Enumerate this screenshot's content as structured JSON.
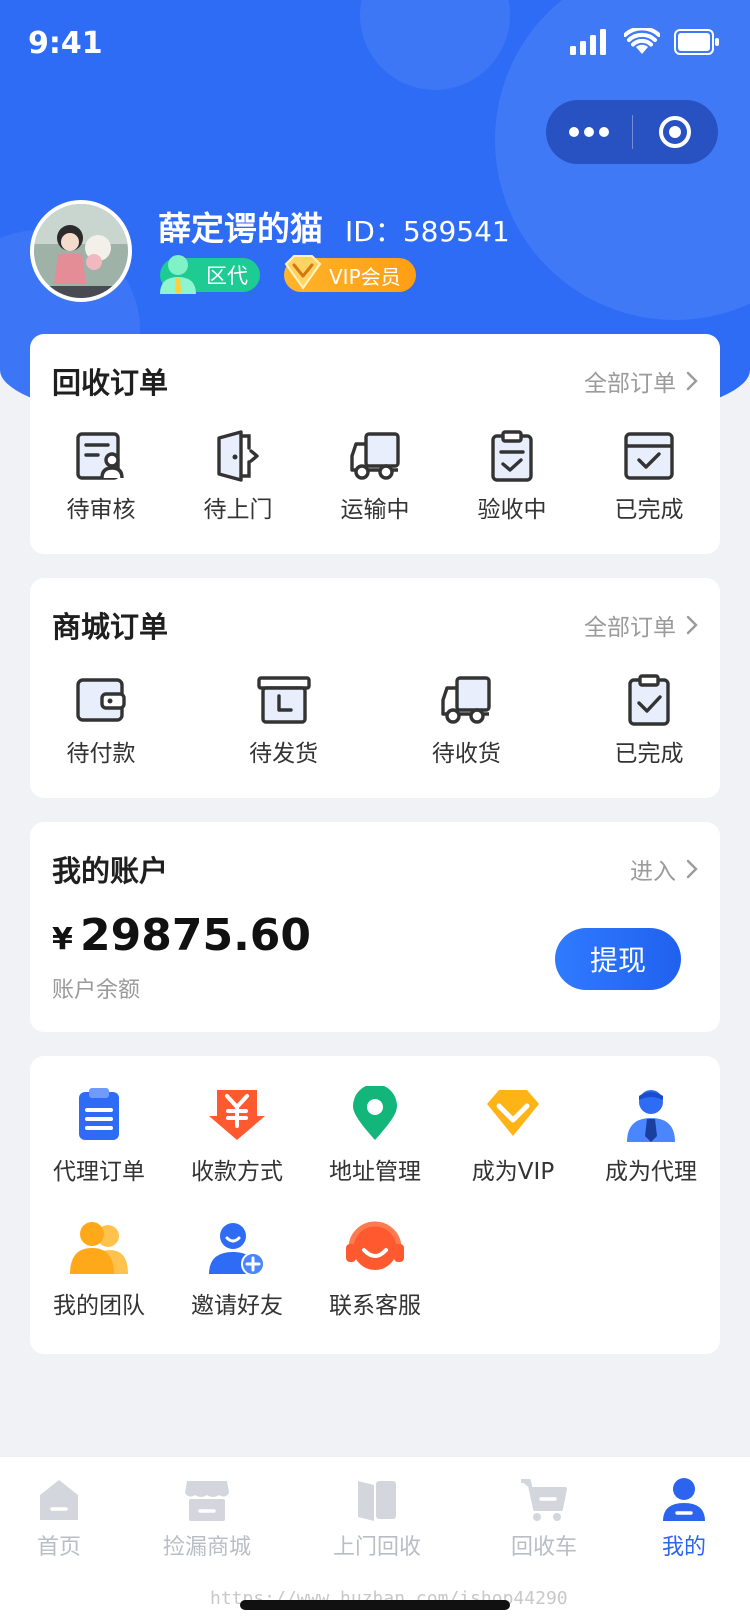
{
  "status_bar": {
    "time": "9:41"
  },
  "profile": {
    "name": "薛定谔的猫",
    "id_text": "ID：589541",
    "agent_badge": "区代",
    "vip_badge": "VIP会员"
  },
  "recycle_orders": {
    "title": "回收订单",
    "link": "全部订单",
    "items": [
      {
        "label": "待审核",
        "icon": "review-doc-icon"
      },
      {
        "label": "待上门",
        "icon": "door-icon"
      },
      {
        "label": "运输中",
        "icon": "truck-icon"
      },
      {
        "label": "验收中",
        "icon": "clipboard-check-icon"
      },
      {
        "label": "已完成",
        "icon": "box-check-icon"
      }
    ]
  },
  "mall_orders": {
    "title": "商城订单",
    "link": "全部订单",
    "items": [
      {
        "label": "待付款",
        "icon": "wallet-icon"
      },
      {
        "label": "待发货",
        "icon": "package-clock-icon"
      },
      {
        "label": "待收货",
        "icon": "truck-icon"
      },
      {
        "label": "已完成",
        "icon": "clipboard-check-icon"
      }
    ]
  },
  "account": {
    "title": "我的账户",
    "link": "进入",
    "currency": "¥",
    "balance": "29875.60",
    "balance_label": "账户余额",
    "withdraw_label": "提现"
  },
  "services": [
    {
      "label": "代理订单",
      "icon": "order-list-icon",
      "color": "#2e6cf6"
    },
    {
      "label": "收款方式",
      "icon": "yuan-payment-icon",
      "color": "#ff5a2f"
    },
    {
      "label": "地址管理",
      "icon": "location-pin-icon",
      "color": "#12b67a"
    },
    {
      "label": "成为VIP",
      "icon": "diamond-icon",
      "color": "#ffb416"
    },
    {
      "label": "成为代理",
      "icon": "agent-person-icon",
      "color": "#2e6cf6"
    },
    {
      "label": "我的团队",
      "icon": "team-icon",
      "color": "#ffa81a"
    },
    {
      "label": "邀请好友",
      "icon": "invite-user-icon",
      "color": "#2e6cf6"
    },
    {
      "label": "联系客服",
      "icon": "headset-icon",
      "color": "#ff5a2f"
    }
  ],
  "tabbar": [
    {
      "label": "首页",
      "icon": "home-icon",
      "active": false
    },
    {
      "label": "捡漏商城",
      "icon": "store-icon",
      "active": false
    },
    {
      "label": "上门回收",
      "icon": "door-recycle-icon",
      "active": false
    },
    {
      "label": "回收车",
      "icon": "cart-icon",
      "active": false
    },
    {
      "label": "我的",
      "icon": "profile-icon",
      "active": true
    }
  ],
  "watermark": "https://www.huzhan.com/ishop44290",
  "colors": {
    "primary": "#2e6cf6",
    "green": "#1ecb93",
    "gold": "#ffab1f",
    "background": "#f1f2f6"
  }
}
